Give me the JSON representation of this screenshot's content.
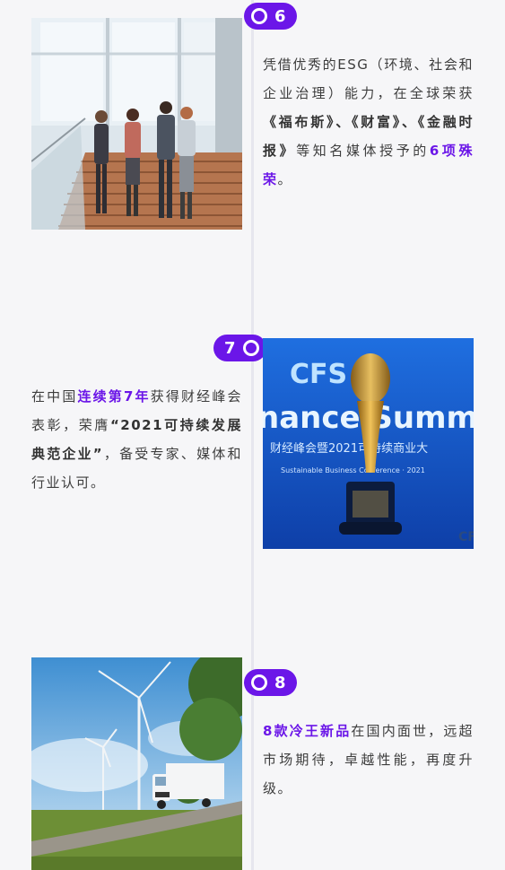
{
  "colors": {
    "accent": "#6b16e8",
    "text": "#3d3d3d",
    "background": "#f6f6f8",
    "line": "#e6e6ee"
  },
  "items": [
    {
      "number": "6",
      "image_desc": "four-people-on-stairs-photo",
      "text": {
        "p1": "凭借优秀的ESG（环境、社会和企业治理）能力，在全球荣获",
        "b1": "《福布斯》、《财富》、《金融时报》",
        "p2": "等知名媒体授予的",
        "h1": "6项殊荣",
        "p3": "。"
      }
    },
    {
      "number": "7",
      "image_desc": "trophy-photo",
      "trophy": {
        "logo": "CFS",
        "banner_left": "nance Summ",
        "banner_cn": "财经峰会暨2021可持续商业大",
        "banner_sub": "Sustainable Business Conference · 2021",
        "corner": "CF"
      },
      "text": {
        "p1": "在中国",
        "h1": "连续第7年",
        "p2": "获得财经峰会表彰，荣膺",
        "b1": "“2021可持续发展典范企业”",
        "p3": "，备受专家、媒体和行业认可。"
      }
    },
    {
      "number": "8",
      "image_desc": "truck-and-wind-turbines-photo",
      "text": {
        "h1": "8款冷王新品",
        "p1": "在国内面世，远超市场期待，卓越性能，再度升级。"
      }
    }
  ]
}
